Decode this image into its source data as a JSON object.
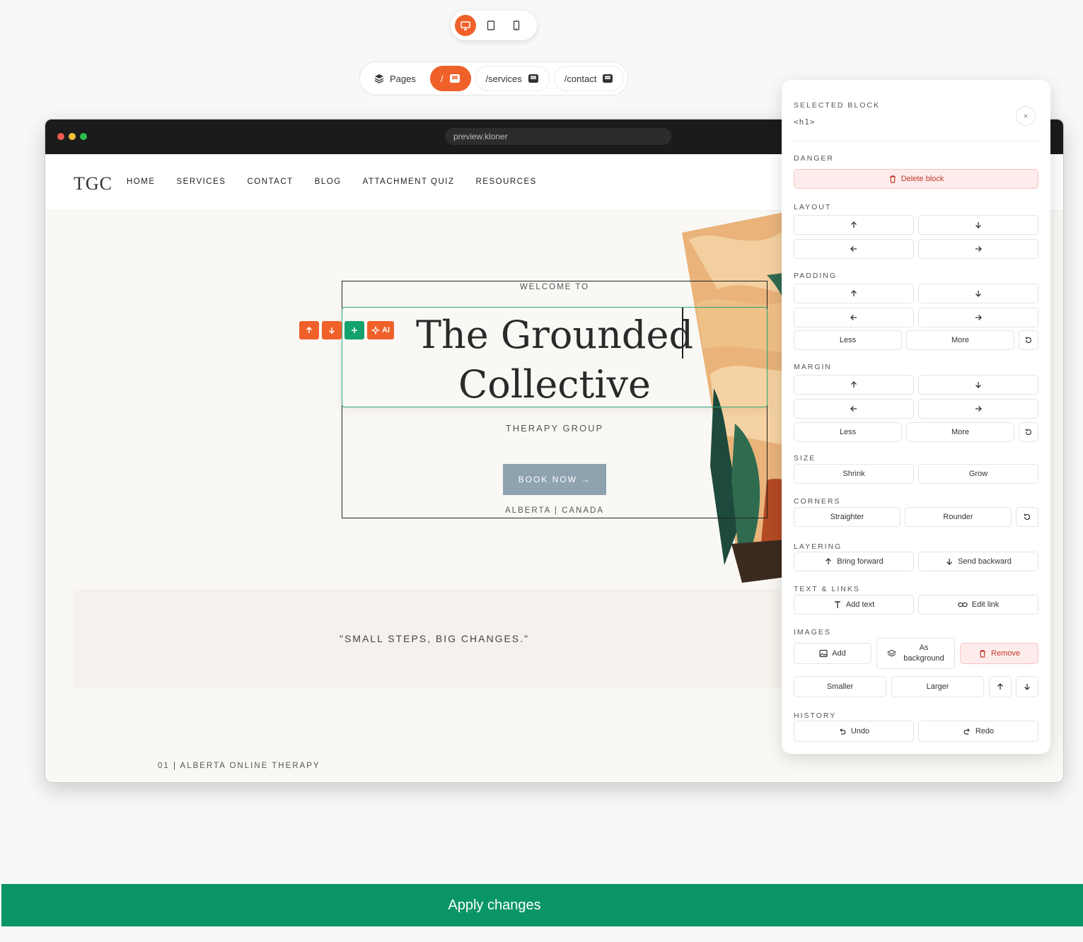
{
  "device_toggle": {
    "icons": [
      "desktop-icon",
      "tablet-icon",
      "mobile-icon"
    ],
    "active": "desktop"
  },
  "pages_bar": {
    "pages_label": "Pages",
    "tabs": [
      {
        "label": "/",
        "active": true
      },
      {
        "label": "/services",
        "active": false
      },
      {
        "label": "/contact",
        "active": false
      }
    ]
  },
  "browser": {
    "url": "preview.kloner"
  },
  "site": {
    "logo": "TGC",
    "nav": [
      "HOME",
      "SERVICES",
      "CONTACT",
      "BLOG",
      "ATTACHMENT QUIZ",
      "RESOURCES"
    ],
    "hero": {
      "welcome": "WELCOME TO",
      "title_line1": "The Grounded",
      "title_line2": "Collective",
      "subtitle": "THERAPY GROUP",
      "cta": "BOOK NOW →",
      "location": "ALBERTA | CANADA"
    },
    "quote": "\"SMALL STEPS, BIG CHANGES.\"",
    "footer_label": "01 | ALBERTA ONLINE THERAPY"
  },
  "block_tools": {
    "ai_label": "AI"
  },
  "panel": {
    "title": "SELECTED BLOCK",
    "tag": "<h1>",
    "close": "×",
    "sections": {
      "danger": "DANGER",
      "layout": "LAYOUT",
      "padding": "PADDING",
      "margin": "MARGIN",
      "size": "SIZE",
      "corners": "CORNERS",
      "layering": "LAYERING",
      "text_links": "TEXT & LINKS",
      "images": "IMAGES",
      "history": "HISTORY"
    },
    "buttons": {
      "delete_block": "Delete block",
      "less": "Less",
      "more": "More",
      "shrink": "Shrink",
      "grow": "Grow",
      "straighter": "Straighter",
      "rounder": "Rounder",
      "bring_forward": "Bring forward",
      "send_backward": "Send backward",
      "add_text": "Add text",
      "edit_link": "Edit link",
      "add_image": "Add",
      "as_background_1": "As",
      "as_background_2": "background",
      "remove": "Remove",
      "smaller": "Smaller",
      "larger": "Larger",
      "undo": "Undo",
      "redo": "Redo"
    }
  },
  "apply_button": "Apply changes",
  "colors": {
    "accent": "#f0612a",
    "success": "#0a9568",
    "selection": "#2aa878",
    "danger": "#c0392b"
  }
}
